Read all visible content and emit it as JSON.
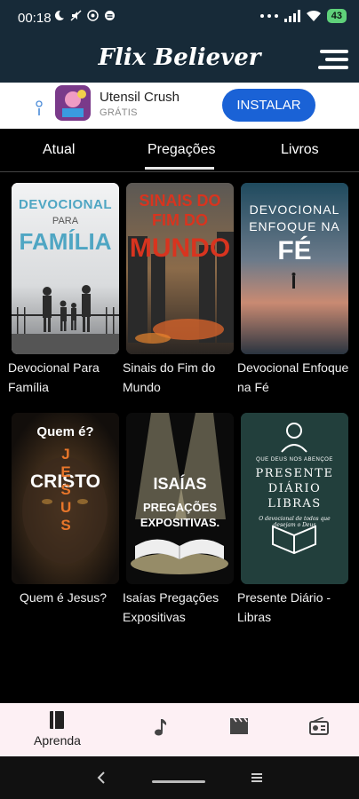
{
  "status_bar": {
    "time": "00:18",
    "battery": "43"
  },
  "app": {
    "title": "Flix Believer"
  },
  "ad": {
    "app_name": "Utensil Crush",
    "store_label": "GRÁTIS",
    "install_label": "INSTALAR"
  },
  "tabs": [
    {
      "label": "Atual"
    },
    {
      "label": "Pregações"
    },
    {
      "label": "Livros"
    }
  ],
  "books": [
    {
      "title": "Devocional Para Família",
      "cover_lines": [
        "DEVOCIONAL",
        "PARA",
        "FAMÍLIA"
      ]
    },
    {
      "title": "Sinais do Fim do Mundo",
      "cover_lines": [
        "SINAIS DO",
        "FIM DO",
        "MUNDO"
      ]
    },
    {
      "title": "Devocional Enfoque na Fé",
      "cover_lines": [
        "DEVOCIONAL",
        "ENFOQUE NA",
        "FÉ"
      ]
    },
    {
      "title": "Quem é Jesus?",
      "cover_lines": [
        "Quem é?",
        "CRISTO",
        "JESUS"
      ]
    },
    {
      "title": "Isaías Pregações Expositivas",
      "cover_lines": [
        "ISAÍAS",
        "PREGAÇÕES",
        "EXPOSITIVAS."
      ]
    },
    {
      "title": "Presente Diário - Libras",
      "cover_lines": [
        "QUE DEUS NOS ABENÇOE",
        "PRESENTE",
        "DIÁRIO",
        "LIBRAS",
        "O devocional de todos que desejam o Deus"
      ]
    }
  ],
  "bottom_nav": [
    {
      "label": "Aprenda",
      "icon": "book-icon",
      "active": true
    },
    {
      "label": "",
      "icon": "music-note-icon"
    },
    {
      "label": "",
      "icon": "clapperboard-icon"
    },
    {
      "label": "",
      "icon": "radio-icon"
    }
  ],
  "colors": {
    "header_bg": "#172a38",
    "accent_button": "#1a62d6",
    "bottom_nav_bg": "#fdf0f4"
  }
}
